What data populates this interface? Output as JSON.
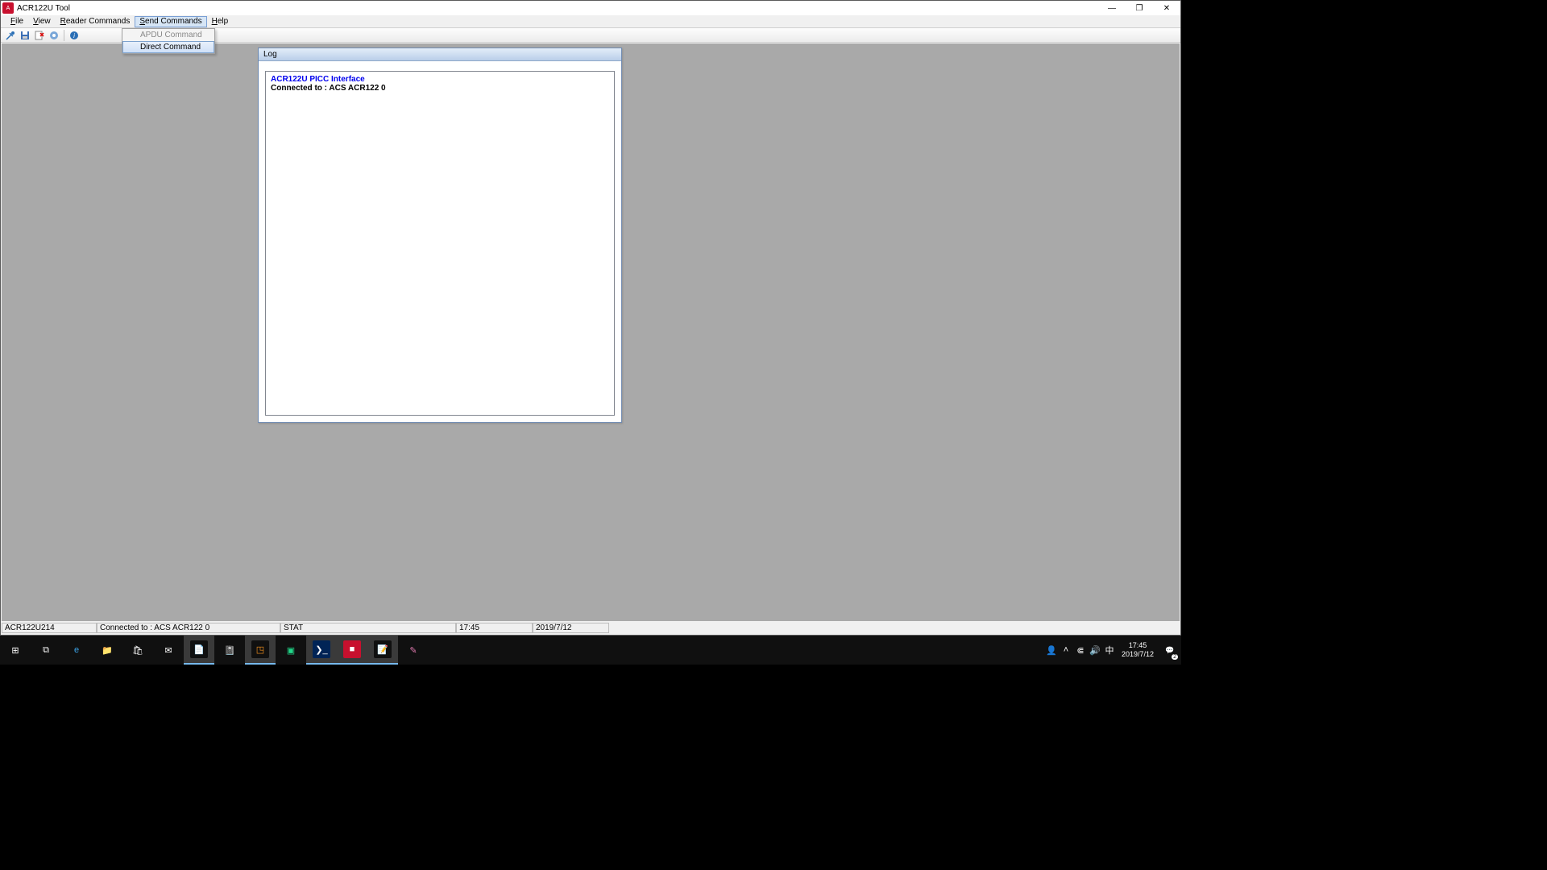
{
  "window": {
    "title": "ACR122U Tool",
    "minimize": "—",
    "maximize": "❐",
    "close": "✕"
  },
  "menubar": {
    "file": "File",
    "view": "View",
    "reader": "Reader Commands",
    "send": "Send Commands",
    "help": "Help"
  },
  "dropdown": {
    "apdu": "APDU Command",
    "direct": "Direct Command"
  },
  "toolbar_icons": {
    "connect": "connect-icon",
    "save": "save-icon",
    "clear": "clear-icon",
    "firmware": "firmware-icon",
    "about": "about-icon"
  },
  "log": {
    "title": "Log",
    "line1": "ACR122U PICC Interface",
    "line2_label": "Connected to :  ",
    "line2_value": "ACS ACR122 0"
  },
  "statusbar": {
    "cell0": "ACR122U214",
    "cell1": "Connected to :  ACS ACR122 0",
    "cell2": "STAT",
    "cell3": "17:45",
    "cell4": "2019/7/12"
  },
  "taskbar": {
    "apps": [
      {
        "name": "start-button",
        "glyph": "⊞",
        "bg": "#101010",
        "fg": "#fff"
      },
      {
        "name": "task-view",
        "glyph": "⧉",
        "bg": "#101010",
        "fg": "#fff"
      },
      {
        "name": "edge",
        "glyph": "e",
        "bg": "#101010",
        "fg": "#3ca4e8"
      },
      {
        "name": "file-explorer",
        "glyph": "📁",
        "bg": "#101010",
        "fg": "#fff"
      },
      {
        "name": "ms-store",
        "glyph": "🛍",
        "bg": "#101010",
        "fg": "#fff"
      },
      {
        "name": "mail",
        "glyph": "✉",
        "bg": "#101010",
        "fg": "#fff"
      },
      {
        "name": "notepadpp",
        "glyph": "📄",
        "bg": "#101010",
        "fg": "#9acd32",
        "active": true
      },
      {
        "name": "notes",
        "glyph": "📓",
        "bg": "#101010",
        "fg": "#b0c4de"
      },
      {
        "name": "vmware",
        "glyph": "◳",
        "bg": "#101010",
        "fg": "#f7931e",
        "active": true
      },
      {
        "name": "pycharm",
        "glyph": "▣",
        "bg": "#101010",
        "fg": "#21d789"
      },
      {
        "name": "powershell",
        "glyph": "❯_",
        "bg": "#012456",
        "fg": "#fff",
        "active": true
      },
      {
        "name": "acr122u-tool",
        "glyph": "■",
        "bg": "#c8102e",
        "fg": "#fff",
        "active": true
      },
      {
        "name": "wordpad",
        "glyph": "📝",
        "bg": "#101010",
        "fg": "#5b9bd5",
        "active": true
      },
      {
        "name": "sketch",
        "glyph": "✎",
        "bg": "#101010",
        "fg": "#e27ab0"
      }
    ],
    "tray": {
      "people": "👤",
      "up": "˄",
      "wifi": "⋐",
      "volume": "🔊",
      "ime": "中",
      "time": "17:45",
      "date": "2019/7/12",
      "notif_glyph": "💬",
      "notif_count": "2"
    }
  }
}
